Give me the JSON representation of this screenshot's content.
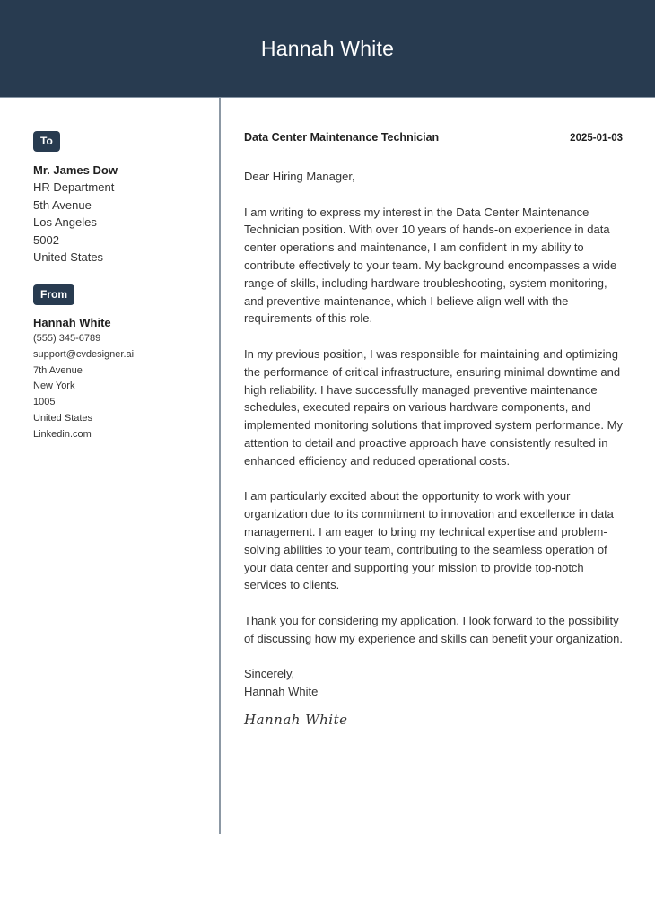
{
  "header": {
    "name": "Hannah White"
  },
  "colors": {
    "accent": "#283b50",
    "divider": "#8c98a4"
  },
  "sidebar": {
    "to": {
      "badge": "To",
      "name": "Mr. James Dow",
      "lines": [
        "HR Department",
        "5th Avenue",
        "Los Angeles",
        "5002",
        "United States"
      ]
    },
    "from": {
      "badge": "From",
      "name": "Hannah White",
      "lines": [
        "(555) 345-6789",
        "support@cvdesigner.ai",
        "7th Avenue",
        "New York",
        "1005",
        "United States",
        "Linkedin.com"
      ]
    }
  },
  "letter": {
    "job_title": "Data Center Maintenance Technician",
    "date": "2025-01-03",
    "greeting": "Dear Hiring Manager,",
    "paragraphs": [
      "I am writing to express my interest in the Data Center Maintenance Technician position. With over 10 years of hands-on experience in data center operations and maintenance, I am confident in my ability to contribute effectively to your team. My background encompasses a wide range of skills, including hardware troubleshooting, system monitoring, and preventive maintenance, which I believe align well with the requirements of this role.",
      "In my previous position, I was responsible for maintaining and optimizing the performance of critical infrastructure, ensuring minimal downtime and high reliability. I have successfully managed preventive maintenance schedules, executed repairs on various hardware components, and implemented monitoring solutions that improved system performance. My attention to detail and proactive approach have consistently resulted in enhanced efficiency and reduced operational costs.",
      "I am particularly excited about the opportunity to work with your organization due to its commitment to innovation and excellence in data management. I am eager to bring my technical expertise and problem-solving abilities to your team, contributing to the seamless operation of your data center and supporting your mission to provide top-notch services to clients.",
      "Thank you for considering my application. I look forward to the possibility of discussing how my experience and skills can benefit your organization."
    ],
    "closing": "Sincerely,",
    "closing_name": "Hannah White",
    "signature": "Hannah White"
  }
}
